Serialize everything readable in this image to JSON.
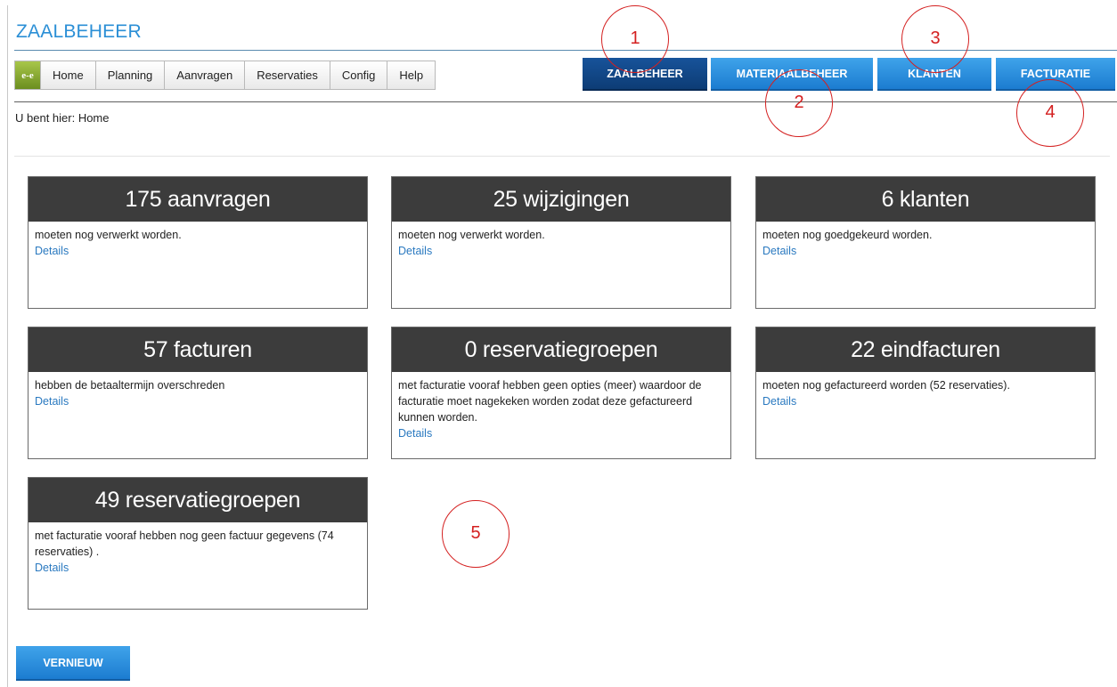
{
  "app": {
    "title": "ZAALBEHEER"
  },
  "menu": {
    "logo": "e-e",
    "items": [
      "Home",
      "Planning",
      "Aanvragen",
      "Reservaties",
      "Config",
      "Help"
    ]
  },
  "modules": [
    "ZAALBEHEER",
    "MATERIAALBEHEER",
    "KLANTEN",
    "FACTURATIE"
  ],
  "active_module": "ZAALBEHEER",
  "breadcrumb": "U bent hier: Home",
  "cards": [
    {
      "title": "175 aanvragen",
      "text": "moeten nog verwerkt worden.",
      "link": "Details"
    },
    {
      "title": "25 wijzigingen",
      "text": "moeten nog verwerkt worden.",
      "link": "Details"
    },
    {
      "title": "6 klanten",
      "text": "moeten nog goedgekeurd worden.",
      "link": "Details"
    },
    {
      "title": "57 facturen",
      "text": "hebben de betaaltermijn overschreden",
      "link": "Details"
    },
    {
      "title": "0 reservatiegroepen",
      "text": "met facturatie vooraf hebben geen opties (meer) waardoor de facturatie moet nagekeken worden zodat deze gefactureerd kunnen worden.",
      "link": "Details"
    },
    {
      "title": "22 eindfacturen",
      "text": "moeten nog gefactureerd worden (52 reservaties).",
      "link": "Details"
    },
    {
      "title": "49 reservatiegroepen",
      "text": "met facturatie vooraf hebben nog geen factuur gegevens (74 reservaties) .",
      "link": "Details"
    }
  ],
  "refresh_button": "VERNIEUW",
  "callouts": [
    "1",
    "2",
    "3",
    "4",
    "5"
  ],
  "colors": {
    "accent": "#2b8fd6",
    "button": "#1c7cd0",
    "button_active": "#0d3c75",
    "card_header": "#3c3c3c",
    "callout": "#d42020"
  }
}
